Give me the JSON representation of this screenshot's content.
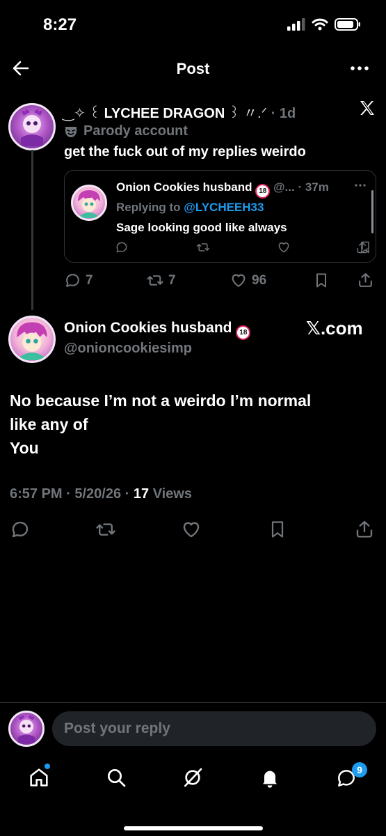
{
  "status_bar": {
    "time": "8:27"
  },
  "header": {
    "title": "Post"
  },
  "original_post": {
    "display_name": "LYCHEE DRAGON",
    "name_prefix": "‿✧ ꒰",
    "name_suffix": "꒱ 〃.ᐟ",
    "time": "· 1d",
    "parody_label": "Parody account",
    "text": "get the fuck out of my replies weirdo",
    "quoted": {
      "author_name": "Onion Cookies husband",
      "author_handle_short": "@...",
      "time": "· 37m",
      "replying_prefix": "Replying to",
      "replying_handle": "@LYCHEEH33",
      "text": "Sage looking good like always"
    },
    "stats": {
      "replies": "7",
      "reposts": "7",
      "likes": "96"
    }
  },
  "reply_post": {
    "display_name": "Onion Cookies husband",
    "handle": "@onioncookiesimp",
    "watermark": "𝕏.com",
    "body_lines": [
      "No because I’m not a weirdo I’m normal",
      "like any of",
      "You"
    ],
    "meta": {
      "time": "6:57 PM",
      "date": "5/20/26",
      "views_count": "17",
      "views_label": "Views"
    }
  },
  "composer": {
    "placeholder": "Post your reply"
  },
  "bottom_nav": {
    "messages_badge": "9"
  },
  "badge_text": "18",
  "colors": {
    "accent": "#1d9bf0",
    "background": "#000000",
    "muted": "#71767b",
    "badge_red": "#e0245e"
  }
}
